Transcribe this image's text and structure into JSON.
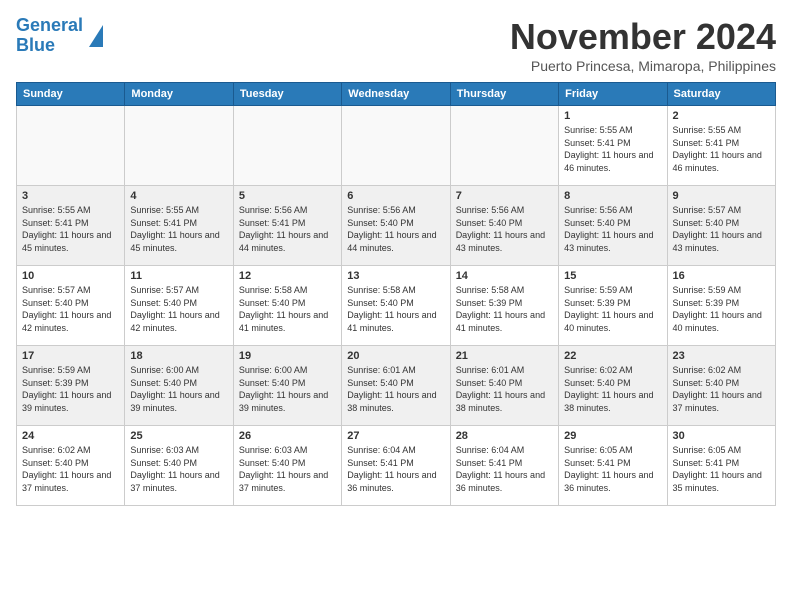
{
  "header": {
    "logo_line1": "General",
    "logo_line2": "Blue",
    "month": "November 2024",
    "location": "Puerto Princesa, Mimaropa, Philippines"
  },
  "weekdays": [
    "Sunday",
    "Monday",
    "Tuesday",
    "Wednesday",
    "Thursday",
    "Friday",
    "Saturday"
  ],
  "weeks": [
    [
      {
        "day": "",
        "info": ""
      },
      {
        "day": "",
        "info": ""
      },
      {
        "day": "",
        "info": ""
      },
      {
        "day": "",
        "info": ""
      },
      {
        "day": "",
        "info": ""
      },
      {
        "day": "1",
        "info": "Sunrise: 5:55 AM\nSunset: 5:41 PM\nDaylight: 11 hours\nand 46 minutes."
      },
      {
        "day": "2",
        "info": "Sunrise: 5:55 AM\nSunset: 5:41 PM\nDaylight: 11 hours\nand 46 minutes."
      }
    ],
    [
      {
        "day": "3",
        "info": "Sunrise: 5:55 AM\nSunset: 5:41 PM\nDaylight: 11 hours\nand 45 minutes."
      },
      {
        "day": "4",
        "info": "Sunrise: 5:55 AM\nSunset: 5:41 PM\nDaylight: 11 hours\nand 45 minutes."
      },
      {
        "day": "5",
        "info": "Sunrise: 5:56 AM\nSunset: 5:41 PM\nDaylight: 11 hours\nand 44 minutes."
      },
      {
        "day": "6",
        "info": "Sunrise: 5:56 AM\nSunset: 5:40 PM\nDaylight: 11 hours\nand 44 minutes."
      },
      {
        "day": "7",
        "info": "Sunrise: 5:56 AM\nSunset: 5:40 PM\nDaylight: 11 hours\nand 43 minutes."
      },
      {
        "day": "8",
        "info": "Sunrise: 5:56 AM\nSunset: 5:40 PM\nDaylight: 11 hours\nand 43 minutes."
      },
      {
        "day": "9",
        "info": "Sunrise: 5:57 AM\nSunset: 5:40 PM\nDaylight: 11 hours\nand 43 minutes."
      }
    ],
    [
      {
        "day": "10",
        "info": "Sunrise: 5:57 AM\nSunset: 5:40 PM\nDaylight: 11 hours\nand 42 minutes."
      },
      {
        "day": "11",
        "info": "Sunrise: 5:57 AM\nSunset: 5:40 PM\nDaylight: 11 hours\nand 42 minutes."
      },
      {
        "day": "12",
        "info": "Sunrise: 5:58 AM\nSunset: 5:40 PM\nDaylight: 11 hours\nand 41 minutes."
      },
      {
        "day": "13",
        "info": "Sunrise: 5:58 AM\nSunset: 5:40 PM\nDaylight: 11 hours\nand 41 minutes."
      },
      {
        "day": "14",
        "info": "Sunrise: 5:58 AM\nSunset: 5:39 PM\nDaylight: 11 hours\nand 41 minutes."
      },
      {
        "day": "15",
        "info": "Sunrise: 5:59 AM\nSunset: 5:39 PM\nDaylight: 11 hours\nand 40 minutes."
      },
      {
        "day": "16",
        "info": "Sunrise: 5:59 AM\nSunset: 5:39 PM\nDaylight: 11 hours\nand 40 minutes."
      }
    ],
    [
      {
        "day": "17",
        "info": "Sunrise: 5:59 AM\nSunset: 5:39 PM\nDaylight: 11 hours\nand 39 minutes."
      },
      {
        "day": "18",
        "info": "Sunrise: 6:00 AM\nSunset: 5:40 PM\nDaylight: 11 hours\nand 39 minutes."
      },
      {
        "day": "19",
        "info": "Sunrise: 6:00 AM\nSunset: 5:40 PM\nDaylight: 11 hours\nand 39 minutes."
      },
      {
        "day": "20",
        "info": "Sunrise: 6:01 AM\nSunset: 5:40 PM\nDaylight: 11 hours\nand 38 minutes."
      },
      {
        "day": "21",
        "info": "Sunrise: 6:01 AM\nSunset: 5:40 PM\nDaylight: 11 hours\nand 38 minutes."
      },
      {
        "day": "22",
        "info": "Sunrise: 6:02 AM\nSunset: 5:40 PM\nDaylight: 11 hours\nand 38 minutes."
      },
      {
        "day": "23",
        "info": "Sunrise: 6:02 AM\nSunset: 5:40 PM\nDaylight: 11 hours\nand 37 minutes."
      }
    ],
    [
      {
        "day": "24",
        "info": "Sunrise: 6:02 AM\nSunset: 5:40 PM\nDaylight: 11 hours\nand 37 minutes."
      },
      {
        "day": "25",
        "info": "Sunrise: 6:03 AM\nSunset: 5:40 PM\nDaylight: 11 hours\nand 37 minutes."
      },
      {
        "day": "26",
        "info": "Sunrise: 6:03 AM\nSunset: 5:40 PM\nDaylight: 11 hours\nand 37 minutes."
      },
      {
        "day": "27",
        "info": "Sunrise: 6:04 AM\nSunset: 5:41 PM\nDaylight: 11 hours\nand 36 minutes."
      },
      {
        "day": "28",
        "info": "Sunrise: 6:04 AM\nSunset: 5:41 PM\nDaylight: 11 hours\nand 36 minutes."
      },
      {
        "day": "29",
        "info": "Sunrise: 6:05 AM\nSunset: 5:41 PM\nDaylight: 11 hours\nand 36 minutes."
      },
      {
        "day": "30",
        "info": "Sunrise: 6:05 AM\nSunset: 5:41 PM\nDaylight: 11 hours\nand 35 minutes."
      }
    ]
  ]
}
